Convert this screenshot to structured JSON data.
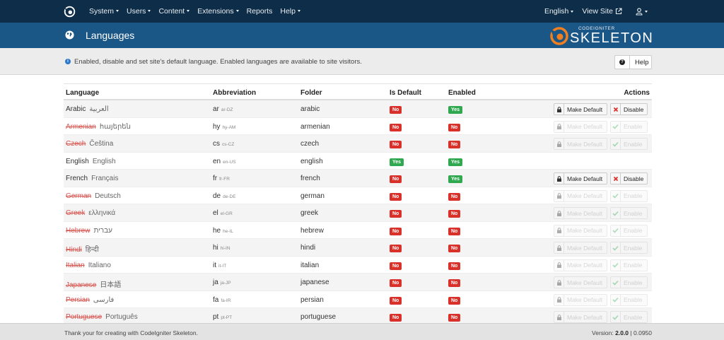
{
  "nav": {
    "menu": [
      {
        "label": "System",
        "dropdown": true
      },
      {
        "label": "Users",
        "dropdown": true
      },
      {
        "label": "Content",
        "dropdown": true
      },
      {
        "label": "Extensions",
        "dropdown": true
      },
      {
        "label": "Reports",
        "dropdown": false
      },
      {
        "label": "Help",
        "dropdown": true
      }
    ],
    "language": "English",
    "view_site": "View Site"
  },
  "header": {
    "title": "Languages",
    "brand_small": "CODEIGNITER",
    "brand_big": "SKELETON"
  },
  "info": {
    "text": "Enabled, disable and set site's default language. Enabled languages are available to site visitors.",
    "help_label": "Help"
  },
  "table": {
    "headers": {
      "language": "Language",
      "abbreviation": "Abbreviation",
      "folder": "Folder",
      "is_default": "Is Default",
      "enabled": "Enabled",
      "actions": "Actions"
    },
    "rows": [
      {
        "name": "Arabic",
        "native": "العربية",
        "abbr": "ar",
        "code": "ar-DZ",
        "folder": "arabic",
        "is_default": "No",
        "enabled": "Yes",
        "actions": "enabled-lang"
      },
      {
        "name": "Armenian",
        "native": "հայերեն",
        "abbr": "hy",
        "code": "hy-AM",
        "folder": "armenian",
        "is_default": "No",
        "enabled": "No",
        "actions": "disabled"
      },
      {
        "name": "Czech",
        "native": "Čeština",
        "abbr": "cs",
        "code": "cs-CZ",
        "folder": "czech",
        "is_default": "No",
        "enabled": "No",
        "actions": "disabled"
      },
      {
        "name": "English",
        "native": "English",
        "abbr": "en",
        "code": "en-US",
        "folder": "english",
        "is_default": "Yes",
        "enabled": "Yes",
        "actions": "none"
      },
      {
        "name": "French",
        "native": "Français",
        "abbr": "fr",
        "code": "fr-FR",
        "folder": "french",
        "is_default": "No",
        "enabled": "Yes",
        "actions": "enabled-lang"
      },
      {
        "name": "German",
        "native": "Deutsch",
        "abbr": "de",
        "code": "de-DE",
        "folder": "german",
        "is_default": "No",
        "enabled": "No",
        "actions": "disabled"
      },
      {
        "name": "Greek",
        "native": "ελληνικά",
        "abbr": "el",
        "code": "el-GR",
        "folder": "greek",
        "is_default": "No",
        "enabled": "No",
        "actions": "disabled"
      },
      {
        "name": "Hebrew",
        "native": "עברית",
        "abbr": "he",
        "code": "he-IL",
        "folder": "hebrew",
        "is_default": "No",
        "enabled": "No",
        "actions": "disabled"
      },
      {
        "name": "Hindi",
        "native": "हिन्दी",
        "abbr": "hi",
        "code": "hi-IN",
        "folder": "hindi",
        "is_default": "No",
        "enabled": "No",
        "actions": "disabled"
      },
      {
        "name": "Italian",
        "native": "Italiano",
        "abbr": "it",
        "code": "it-IT",
        "folder": "italian",
        "is_default": "No",
        "enabled": "No",
        "actions": "disabled"
      },
      {
        "name": "Japanese",
        "native": "日本語",
        "abbr": "ja",
        "code": "ja-JP",
        "folder": "japanese",
        "is_default": "No",
        "enabled": "No",
        "actions": "disabled"
      },
      {
        "name": "Persian",
        "native": "فارسی",
        "abbr": "fa",
        "code": "fa-IR",
        "folder": "persian",
        "is_default": "No",
        "enabled": "No",
        "actions": "disabled"
      },
      {
        "name": "Portuguese",
        "native": "Português",
        "abbr": "pt",
        "code": "pt-PT",
        "folder": "portuguese",
        "is_default": "No",
        "enabled": "No",
        "actions": "disabled"
      }
    ],
    "make_default_label": "Make Default",
    "disable_label": "Disable",
    "enable_label": "Enable"
  },
  "footer": {
    "left": "Thank your for creating with CodeIgniter Skeleton.",
    "version_label": "Version:",
    "version": "2.0.0",
    "time": "0.0950"
  },
  "colors": {
    "navbar": "#0e2d48",
    "header": "#1b5786",
    "badge_no": "#d9302a",
    "badge_yes": "#2fa84f",
    "brand_orange": "#f07f22"
  }
}
